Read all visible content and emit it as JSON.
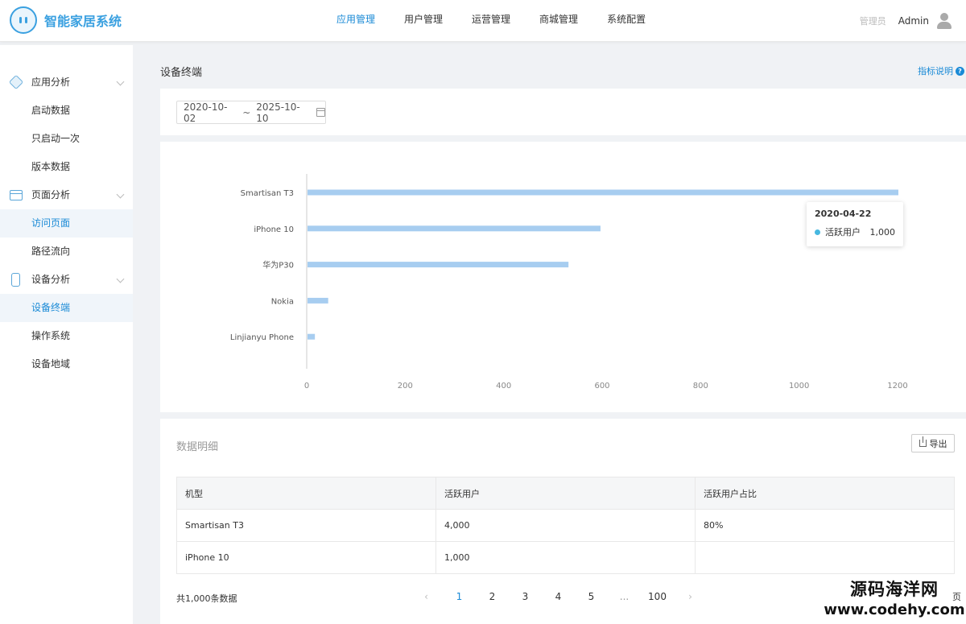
{
  "app": {
    "title": "智能家居系统"
  },
  "topnav": {
    "items": [
      {
        "label": "应用管理",
        "active": true
      },
      {
        "label": "用户管理"
      },
      {
        "label": "运营管理"
      },
      {
        "label": "商城管理"
      },
      {
        "label": "系统配置"
      }
    ]
  },
  "header": {
    "role": "管理员",
    "user": "Admin"
  },
  "sidebar": {
    "groups": [
      {
        "label": "应用分析",
        "icon": "cube-icon",
        "items": [
          "启动数据",
          "只启动一次",
          "版本数据"
        ]
      },
      {
        "label": "页面分析",
        "icon": "window-icon",
        "items": [
          "访问页面",
          "路径流向"
        ]
      },
      {
        "label": "设备分析",
        "icon": "phone-icon",
        "items": [
          "设备终端",
          "操作系统",
          "设备地域"
        ]
      }
    ],
    "active_items": [
      "访问页面",
      "设备终端"
    ]
  },
  "page": {
    "title": "设备终端",
    "help": "指标说明",
    "help_icon": "question-icon"
  },
  "filter": {
    "date_start": "2020-10-02",
    "separator": "~",
    "date_end": "2025-10-10",
    "icon": "calendar-icon"
  },
  "chart_data": {
    "type": "bar",
    "orientation": "horizontal",
    "categories": [
      "Smartisan T3",
      "iPhone 10",
      "华为P30",
      "Nokia",
      "Linjianyu Phone"
    ],
    "values": [
      1200,
      595,
      530,
      42,
      15
    ],
    "xlim": [
      0,
      1200
    ],
    "xticks": [
      0,
      200,
      400,
      600,
      800,
      1000,
      1200
    ],
    "bar_color": "#a7cdf0",
    "grid": false,
    "tooltip": {
      "date": "2020-04-22",
      "series": "活跃用户",
      "value": "1,000"
    }
  },
  "table": {
    "title": "数据明细",
    "export_label": "导出",
    "columns": [
      "机型",
      "活跃用户",
      "活跃用户占比"
    ],
    "rows": [
      [
        "Smartisan T3",
        "4,000",
        "80%"
      ],
      [
        "iPhone 10",
        "1,000",
        ""
      ]
    ]
  },
  "pagination": {
    "total": "共1,000条数据",
    "pages": [
      "1",
      "2",
      "3",
      "4",
      "5",
      "...",
      "100"
    ],
    "current": "1",
    "suffix": "页"
  },
  "watermark": {
    "line1": "源码海洋网",
    "line2": "www.codehy.com"
  },
  "colors": {
    "accent": "#1a8ad6",
    "logo": "#3aa0e0",
    "bar": "#a7cdf0"
  }
}
